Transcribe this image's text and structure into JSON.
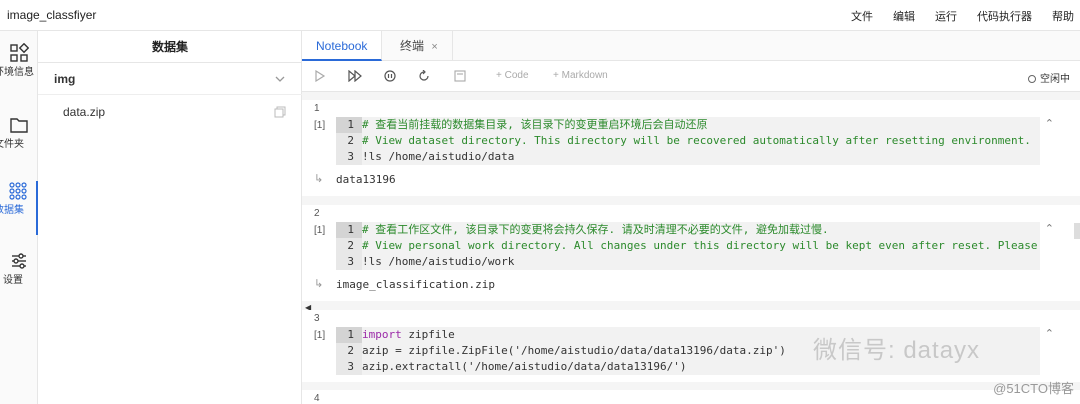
{
  "app": {
    "title": "image_classfiyer"
  },
  "menu": [
    "文件",
    "编辑",
    "运行",
    "代码执行器",
    "帮助"
  ],
  "nav": [
    {
      "label": "环境信息",
      "icon": "grid-icon"
    },
    {
      "label": "文件夹",
      "icon": "folder-icon"
    },
    {
      "label": "数据集",
      "icon": "dataset-icon",
      "active": true
    },
    {
      "label": "设置",
      "icon": "sliders-icon"
    }
  ],
  "dataset_panel": {
    "title": "数据集",
    "group": "img",
    "files": [
      "data.zip"
    ]
  },
  "tabs": [
    {
      "label": "Notebook",
      "active": true
    },
    {
      "label": "终端",
      "close": "×"
    }
  ],
  "toolbar": {
    "add_code": "+ Code",
    "add_markdown": "+ Markdown",
    "kernel_status": "空闲中"
  },
  "cells": [
    {
      "number": "1",
      "prompt": "[1]",
      "lines": [
        "# 查看当前挂载的数据集目录, 该目录下的变更重启环境后会自动还原",
        "# View dataset directory. This directory will be recovered automatically after resetting environment.",
        "!ls /home/aistudio/data"
      ],
      "output": "data13196"
    },
    {
      "number": "2",
      "prompt": "[1]",
      "lines": [
        "# 查看工作区文件, 该目录下的变更将会持久保存. 请及时清理不必要的文件, 避免加载过慢.",
        "# View personal work directory. All changes under this directory will be kept even after reset. Please c",
        "!ls /home/aistudio/work"
      ],
      "output": "image_classification.zip"
    },
    {
      "number": "3",
      "prompt": "[1]",
      "lines": [
        "import zipfile",
        "azip = zipfile.ZipFile('/home/aistudio/data/data13196/data.zip')",
        "azip.extractall('/home/aistudio/data/data13196/')"
      ]
    },
    {
      "number": "4"
    }
  ],
  "watermark": {
    "main": "微信号: datayx",
    "corner": "@51CTO博客"
  }
}
